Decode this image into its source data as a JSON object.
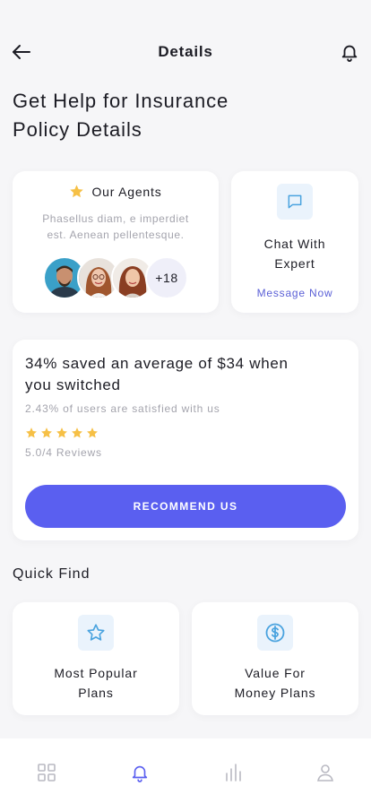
{
  "header": {
    "title": "Details",
    "back_icon": "arrow-left-icon",
    "notification_icon": "bell-icon"
  },
  "page": {
    "title_line1": "Get Help for Insurance",
    "title_line2": "Policy Details"
  },
  "agents_card": {
    "icon": "star-icon",
    "title": "Our Agents",
    "desc_line1": "Phasellus  diam, e imperdiet",
    "desc_line2": "est. Aenean pellentesque.",
    "extra_count": "+18"
  },
  "chat_card": {
    "icon": "chat-bubble-icon",
    "title_line1": "Chat With",
    "title_line2": "Expert",
    "link": "Message Now"
  },
  "stats_card": {
    "headline_line1": "34% saved an average of $34 when",
    "headline_line2": "you switched",
    "subtext": "2.43% of users are satisfied with us",
    "rating_stars": 5,
    "reviews": "5.0/4 Reviews",
    "button_label": "RECOMMEND US"
  },
  "quick_find": {
    "title": "Quick Find",
    "items": [
      {
        "icon": "star-outline-icon",
        "line1": "Most Popular",
        "line2": "Plans"
      },
      {
        "icon": "dollar-circle-icon",
        "line1": "Value For",
        "line2": "Money Plans"
      }
    ]
  },
  "tabbar": {
    "items": [
      {
        "icon": "grid-icon",
        "active": false
      },
      {
        "icon": "bell-icon",
        "active": true
      },
      {
        "icon": "bar-chart-icon",
        "active": false
      },
      {
        "icon": "user-icon",
        "active": false
      }
    ]
  },
  "colors": {
    "accent": "#5a5ff0",
    "link": "#5a5fd6",
    "star": "#f6c046",
    "icon_blue": "#4aa3df",
    "muted_text": "#a4a4ad"
  }
}
